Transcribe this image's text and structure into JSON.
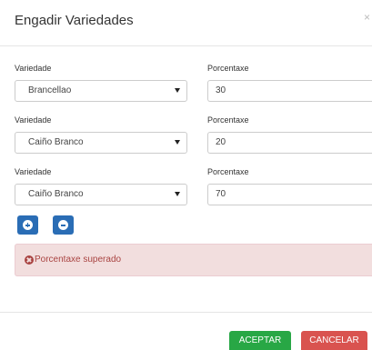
{
  "modal": {
    "title": "Engadir Variedades",
    "close_mark": "×"
  },
  "rows": [
    {
      "variety_label": "Variedade",
      "variety_value": "Brancellao",
      "percent_label": "Porcentaxe",
      "percent_value": "30"
    },
    {
      "variety_label": "Variedade",
      "variety_value": "Caiño Branco",
      "percent_label": "Porcentaxe",
      "percent_value": "20"
    },
    {
      "variety_label": "Variedade",
      "variety_value": "Caiño Branco",
      "percent_label": "Porcentaxe",
      "percent_value": "70"
    }
  ],
  "actions": {
    "add_icon": "plus-circle-icon",
    "remove_icon": "minus-circle-icon"
  },
  "alert": {
    "icon": "times-circle-icon",
    "message": "Porcentaxe superado",
    "color": "#a94442",
    "background": "#f2dede"
  },
  "footer": {
    "accept_label": "ACEPTAR",
    "cancel_label": "CANCELAR",
    "accept_color": "#28a745",
    "cancel_color": "#d9534f"
  }
}
